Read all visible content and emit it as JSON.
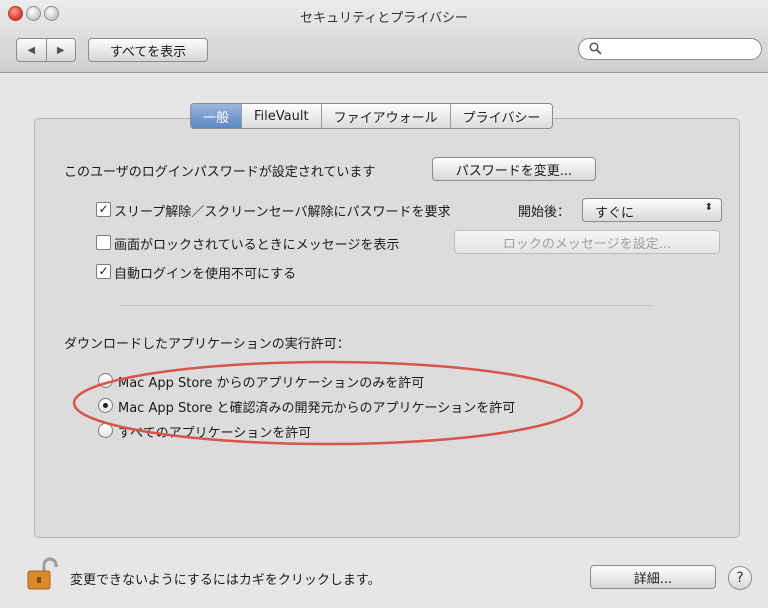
{
  "window": {
    "title": "セキュリティとプライバシー"
  },
  "toolbar": {
    "back_icon": "◀",
    "forward_icon": "▶",
    "show_all_label": "すべてを表示",
    "search_placeholder": ""
  },
  "tabs": [
    {
      "label": "一般",
      "selected": true
    },
    {
      "label": "FileVault",
      "selected": false
    },
    {
      "label": "ファイアウォール",
      "selected": false
    },
    {
      "label": "プライバシー",
      "selected": false
    }
  ],
  "general": {
    "password_text": "このユーザのログインパスワードが設定されています",
    "change_password_label": "パスワードを変更...",
    "require_password": {
      "label": "スリープ解除／スクリーンセーバ解除にパスワードを要求",
      "checked": true
    },
    "delay_label": "開始後：",
    "delay_value": "すぐに",
    "show_message": {
      "label": "画面がロックされているときにメッセージを表示",
      "checked": false
    },
    "set_message_label": "ロックのメッセージを設定...",
    "disable_autologin": {
      "label": "自動ログインを使用不可にする",
      "checked": true
    },
    "downloads_heading": "ダウンロードしたアプリケーションの実行許可：",
    "options": [
      {
        "label": "Mac App Store からのアプリケーションのみを許可",
        "selected": false
      },
      {
        "label": "Mac App Store と確認済みの開発元からのアプリケーションを許可",
        "selected": true
      },
      {
        "label": "すべてのアプリケーションを許可",
        "selected": false
      }
    ]
  },
  "footer": {
    "lock_text": "変更できないようにするにはカギをクリックします。",
    "advanced_label": "詳細...",
    "help_label": "?"
  },
  "colors": {
    "annotation": "#d9554a",
    "tab_selected": "#6a90c9",
    "lock": "#d98a2b"
  }
}
